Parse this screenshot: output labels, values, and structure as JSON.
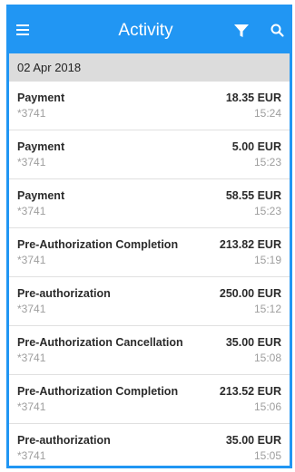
{
  "topbar": {
    "title": "Activity",
    "menu_icon": "hamburger-menu-icon",
    "filter_icon": "filter-funnel-icon",
    "search_icon": "search-icon",
    "accent_color": "#2196f3"
  },
  "date_header": "02 Apr 2018",
  "transactions": [
    {
      "name": "Payment",
      "card": "*3741",
      "amount": "18.35 EUR",
      "time": "15:24"
    },
    {
      "name": "Payment",
      "card": "*3741",
      "amount": "5.00 EUR",
      "time": "15:23"
    },
    {
      "name": "Payment",
      "card": "*3741",
      "amount": "58.55 EUR",
      "time": "15:23"
    },
    {
      "name": "Pre-Authorization Completion",
      "card": "*3741",
      "amount": "213.82 EUR",
      "time": "15:19"
    },
    {
      "name": "Pre-authorization",
      "card": "*3741",
      "amount": "250.00 EUR",
      "time": "15:12"
    },
    {
      "name": "Pre-Authorization Cancellation",
      "card": "*3741",
      "amount": "35.00 EUR",
      "time": "15:08"
    },
    {
      "name": "Pre-Authorization Completion",
      "card": "*3741",
      "amount": "213.52 EUR",
      "time": "15:06"
    },
    {
      "name": "Pre-authorization",
      "card": "*3741",
      "amount": "35.00 EUR",
      "time": "15:05"
    }
  ]
}
